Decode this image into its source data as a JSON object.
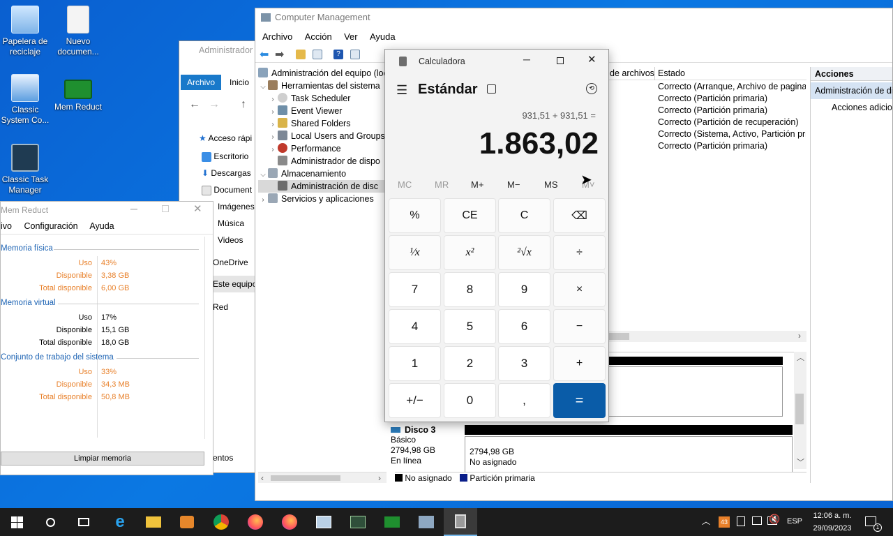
{
  "desktop": {
    "icons": [
      {
        "label": "Papelera de reciclaje"
      },
      {
        "label": "Nuevo documen..."
      },
      {
        "label": "Classic System Co..."
      },
      {
        "label": "Mem Reduct"
      },
      {
        "label": "Classic Task Manager"
      }
    ]
  },
  "explorer": {
    "title": "Administrador",
    "tabs": [
      "Archivo",
      "Inicio"
    ],
    "nav": [
      "Acceso rápi",
      "Escritorio",
      "Descargas",
      "Document",
      "Imágenes",
      "Música",
      "Videos",
      "OneDrive",
      "Este equipo",
      "Red"
    ],
    "footer": "entos"
  },
  "comp_mgmt": {
    "title": "Computer Management",
    "menu": [
      "Archivo",
      "Acción",
      "Ver",
      "Ayuda"
    ],
    "tree": [
      {
        "label": "Administración del equipo (loc",
        "level": 0
      },
      {
        "label": "Herramientas del sistema",
        "level": 1
      },
      {
        "label": "Task Scheduler",
        "level": 2
      },
      {
        "label": "Event Viewer",
        "level": 2
      },
      {
        "label": "Shared Folders",
        "level": 2
      },
      {
        "label": "Local Users and Groups",
        "level": 2
      },
      {
        "label": "Performance",
        "level": 2
      },
      {
        "label": "Administrador de dispo",
        "level": 2
      },
      {
        "label": "Almacenamiento",
        "level": 1
      },
      {
        "label": "Administración de disc",
        "level": 2
      },
      {
        "label": "Servicios y aplicaciones",
        "level": 1
      }
    ],
    "columns": [
      "de archivos",
      "Estado"
    ],
    "status_rows": [
      "Correcto (Arranque, Archivo de paginaci",
      "Correcto (Partición primaria)",
      "Correcto (Partición primaria)",
      "Correcto (Partición de recuperación)",
      "Correcto (Sistema, Activo, Partición prim",
      "Correcto (Partición primaria)"
    ],
    "actions_header": "Acciones",
    "actions_selected": "Administración de dis",
    "actions_more": "Acciones adicior",
    "disk": {
      "name": "Disco 3",
      "type": "Básico",
      "size": "2794,98 GB",
      "status": "En línea",
      "part_size": "2794,98 GB",
      "part_state": "No asignado"
    },
    "legend": [
      "No asignado",
      "Partición primaria"
    ]
  },
  "calculator": {
    "title": "Calculadora",
    "mode": "Estándar",
    "expression": "931,51 + 931,51 =",
    "result": "1.863,02",
    "memory": [
      "MC",
      "MR",
      "M+",
      "M−",
      "MS",
      "M˅"
    ],
    "buttons": [
      "%",
      "CE",
      "C",
      "⌫",
      "¹⁄x",
      "x²",
      "²√x",
      "÷",
      "7",
      "8",
      "9",
      "×",
      "4",
      "5",
      "6",
      "−",
      "1",
      "2",
      "3",
      "+",
      "+/−",
      "0",
      ",",
      "="
    ]
  },
  "mem_reduct": {
    "title": "Mem Reduct",
    "menu": [
      "ivo",
      "Configuración",
      "Ayuda"
    ],
    "sections": [
      {
        "title": "Memoria física",
        "rows": [
          [
            "Uso",
            "43%"
          ],
          [
            "Disponible",
            "3,38 GB"
          ],
          [
            "Total disponible",
            "6,00 GB"
          ]
        ],
        "highlight": true
      },
      {
        "title": "Memoria virtual",
        "rows": [
          [
            "Uso",
            "17%"
          ],
          [
            "Disponible",
            "15,1 GB"
          ],
          [
            "Total disponible",
            "18,0 GB"
          ]
        ],
        "highlight": false
      },
      {
        "title": "Conjunto de trabajo del sistema",
        "rows": [
          [
            "Uso",
            "33%"
          ],
          [
            "Disponible",
            "34,3 MB"
          ],
          [
            "Total disponible",
            "50,8 MB"
          ]
        ],
        "highlight": true
      }
    ],
    "button": "Limpiar memoria"
  },
  "taskbar": {
    "lang": "ESP",
    "time": "12:06 a. m.",
    "date": "29/09/2023",
    "notif_count": "1",
    "tray_badge": "43"
  },
  "colors": {
    "accent": "#0a5ca8",
    "orange": "#e8802a",
    "desktop": "#0b6fdc"
  }
}
